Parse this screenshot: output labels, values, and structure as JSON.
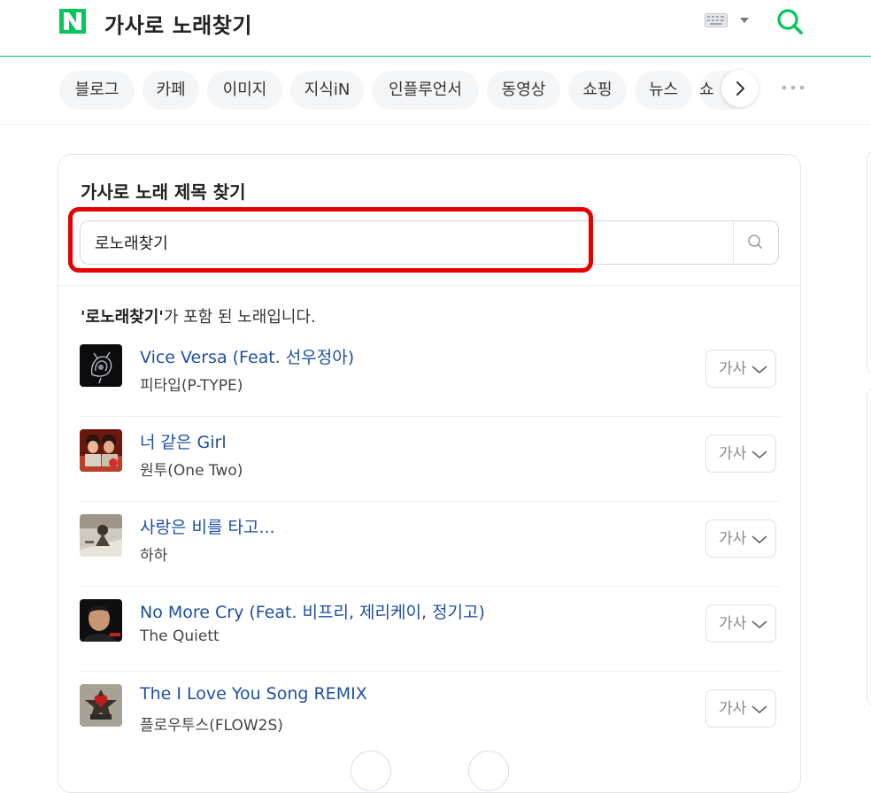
{
  "header": {
    "logo_letter": "N",
    "query": "가사로 노래찾기",
    "brand_color": "#03c75a"
  },
  "tabs": [
    "블로그",
    "카페",
    "이미지",
    "지식iN",
    "인플루언서",
    "동영상",
    "쇼핑",
    "뉴스",
    "쇼"
  ],
  "card": {
    "title": "가사로 노래 제목 찾기",
    "search_value": "로노래찾기",
    "result_keyword": "'로노래찾기'",
    "result_suffix": "가 포함 된 노래입니다.",
    "lyrics_label": "가사"
  },
  "songs": [
    {
      "title": "Vice Versa (Feat. 선우정아)",
      "artist": "피타입(P-TYPE)"
    },
    {
      "title": "너 같은 Girl",
      "artist": "원투(One Two)"
    },
    {
      "title": "사랑은 비를 타고...",
      "artist": "하하"
    },
    {
      "title": "No More Cry (Feat. 비프리, 제리케이, 정기고)",
      "artist": "The Quiett"
    },
    {
      "title": "The I Love You Song REMIX",
      "artist": "플로우투스(FLOW2S)"
    }
  ],
  "colors": {
    "accent": "#03c75a",
    "link": "#1f4fa3",
    "highlight": "#e80000"
  }
}
